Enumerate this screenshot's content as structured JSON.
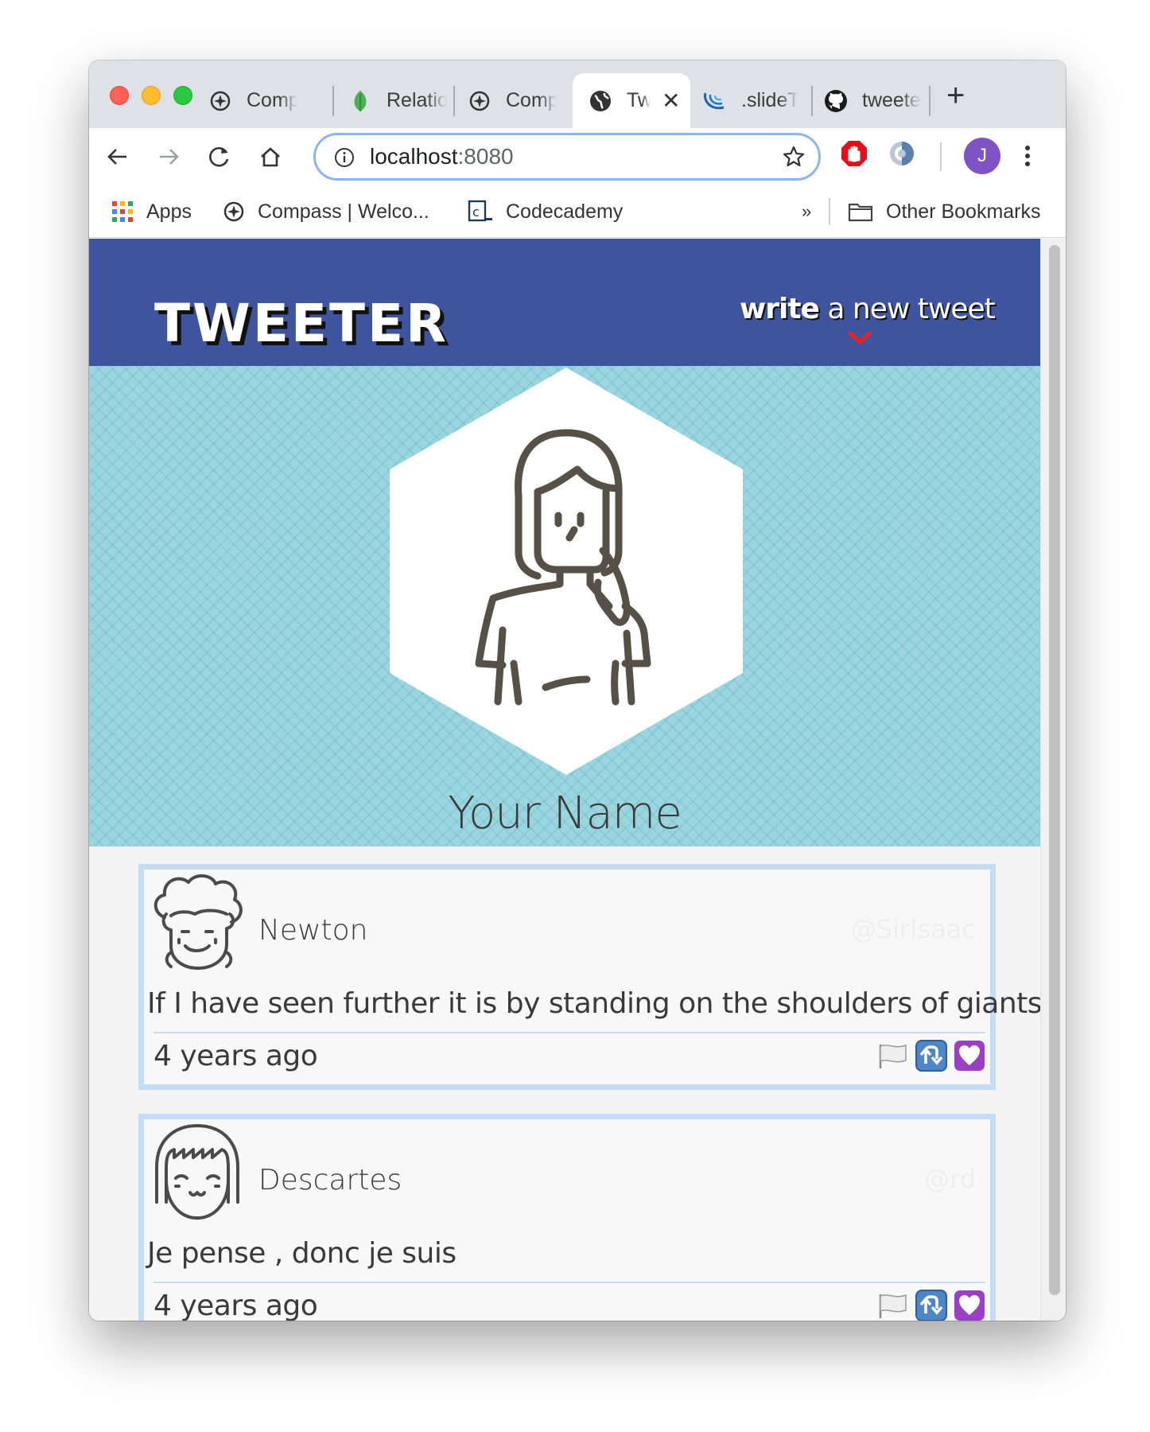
{
  "browser": {
    "tabs": [
      {
        "label": "Compass",
        "icon": "compass-icon"
      },
      {
        "label": "Relationships",
        "icon": "leaf-icon"
      },
      {
        "label": "Compass",
        "icon": "compass-icon"
      },
      {
        "label": "Tweeter",
        "icon": "globe-icon",
        "active": true
      },
      {
        "label": ".slideToggle",
        "icon": "jquery-icon"
      },
      {
        "label": "tweeter",
        "icon": "github-icon"
      }
    ],
    "url_host": "localhost",
    "url_port": ":8080",
    "profile_initial": "J",
    "bookmarks": [
      {
        "label": "Apps",
        "icon": "apps-grid-icon"
      },
      {
        "label": "Compass | Welco...",
        "icon": "compass-icon"
      },
      {
        "label": "Codecademy",
        "icon": "codecademy-icon"
      }
    ],
    "bookmarks_overflow": "»",
    "other_bookmarks": "Other Bookmarks"
  },
  "page": {
    "brand": "TWEETER",
    "compose_bold": "write",
    "compose_rest": " a new tweet",
    "profile_name": "Your Name",
    "tweets": [
      {
        "name": "Newton",
        "handle": "@SirIsaac",
        "text": "If I have seen further it is by standing on the shoulders of giants",
        "time": "4 years ago"
      },
      {
        "name": "Descartes",
        "handle": "@rd",
        "text": "Je pense , donc je suis",
        "time": "4 years ago"
      }
    ]
  },
  "colors": {
    "navbar": "#3f549e",
    "profile_bg": "#9bd6df",
    "tweet_border": "#c4dcf6",
    "accent_chevron": "#e8231f"
  }
}
